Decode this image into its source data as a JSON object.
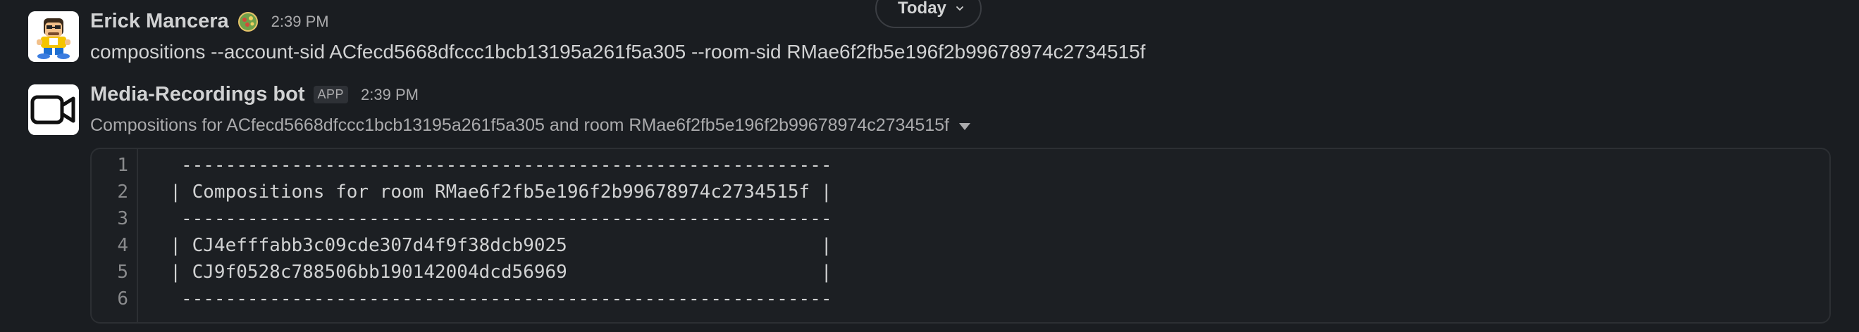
{
  "divider": {
    "label": "Today"
  },
  "message1": {
    "sender": "Erick Mancera",
    "status_emoji": "party-globe-emoji",
    "time": "2:39 PM",
    "text": "compositions --account-sid ACfecd5668dfccc1bcb13195a261f5a305 --room-sid RMae6f2fb5e196f2b99678974c2734515f"
  },
  "message2": {
    "sender": "Media-Recordings bot",
    "badge": "APP",
    "time": "2:39 PM",
    "attachment_title": "Compositions for ACfecd5668dfccc1bcb13195a261f5a305 and room RMae6f2fb5e196f2b99678974c2734515f",
    "snippet": {
      "line_numbers": [
        "1",
        "2",
        "3",
        "4",
        "5",
        "6"
      ],
      "lines": [
        "   -----------------------------------------------------------",
        "  | Compositions for room RMae6f2fb5e196f2b99678974c2734515f |",
        "   -----------------------------------------------------------",
        "  | CJ4efffabb3c09cde307d4f9f38dcb9025                       |",
        "  | CJ9f0528c788506bb190142004dcd56969                       |",
        "   -----------------------------------------------------------"
      ]
    }
  },
  "icons": {
    "date_chevron": "chevron-down-icon",
    "bot_avatar": "video-camera-icon",
    "attachment_toggle": "caret-down-icon"
  }
}
